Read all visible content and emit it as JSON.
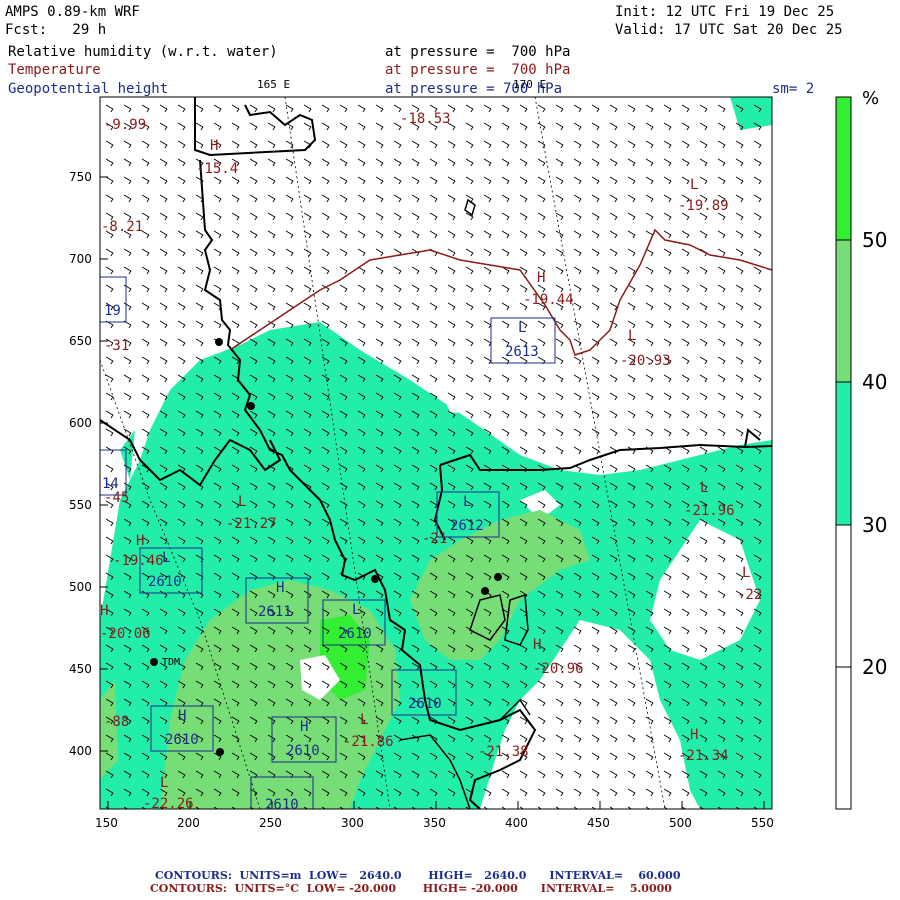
{
  "header": {
    "model": "AMPS 0.89-km WRF",
    "init": "Init: 12 UTC Fri 19 Dec 25",
    "fcst": "Fcst:   29 h",
    "valid": "Valid: 17 UTC Sat 20 Dec 25",
    "field1": "Relative humidity (w.r.t. water)",
    "field1_level": "at pressure =  700 hPa",
    "field2": "Temperature",
    "field2_level": "at pressure =  700 hPa",
    "field3": "Geopotential height",
    "field3_level": "at pressure = 700 hPa",
    "lon1": "165 E",
    "lon2": "170 E",
    "sm": "sm= 2"
  },
  "axes": {
    "x_ticks": [
      "150",
      "200",
      "250",
      "300",
      "350",
      "400",
      "450",
      "500",
      "550"
    ],
    "y_ticks": [
      "750",
      "700",
      "650",
      "600",
      "550",
      "500",
      "450",
      "400"
    ]
  },
  "colorbar": {
    "unit": "%",
    "labels": [
      "50",
      "40",
      "30",
      "20"
    ],
    "colors": [
      "#33ee33",
      "#77dd77",
      "#22eeaa",
      "#ffffff",
      "#ffffff"
    ]
  },
  "map_labels": {
    "temps": [
      {
        "name": "t1",
        "text": "-9.99"
      },
      {
        "name": "t2",
        "text": "-15.4"
      },
      {
        "name": "t3",
        "text": "-18.53"
      },
      {
        "name": "t4",
        "text": "-8.21"
      },
      {
        "name": "t5",
        "text": "-19.89"
      },
      {
        "name": "t6",
        "text": "-19.44"
      },
      {
        "name": "t7",
        "text": "-20.93"
      },
      {
        "name": "t8",
        "text": "-31"
      },
      {
        "name": "t9",
        "text": "-21.27"
      },
      {
        "name": "t10",
        "text": "-21.96"
      },
      {
        "name": "t11",
        "text": "-19.46"
      },
      {
        "name": "t12",
        "text": "-20.06"
      },
      {
        "name": "t13",
        "text": "-22"
      },
      {
        "name": "t14",
        "text": "-20.96"
      },
      {
        "name": "t15",
        "text": "-21.86"
      },
      {
        "name": "t16",
        "text": "-21.38"
      },
      {
        "name": "t17",
        "text": "-21.34"
      },
      {
        "name": "t18",
        "text": "-88"
      },
      {
        "name": "t19",
        "text": "-22.26"
      },
      {
        "name": "t20",
        "text": "-21"
      },
      {
        "name": "t21",
        "text": "-45"
      }
    ],
    "heights": [
      {
        "name": "h1",
        "text": "2613"
      },
      {
        "name": "h2",
        "text": "2612"
      },
      {
        "name": "h3",
        "text": "2610"
      },
      {
        "name": "h4",
        "text": "2611"
      },
      {
        "name": "h5",
        "text": "2610"
      },
      {
        "name": "h6",
        "text": "2610"
      },
      {
        "name": "h7",
        "text": "2610"
      },
      {
        "name": "h8",
        "text": "2610"
      },
      {
        "name": "h9",
        "text": "19"
      },
      {
        "name": "h10",
        "text": "14"
      },
      {
        "name": "h11",
        "text": "2610"
      }
    ],
    "station": "TDM"
  },
  "footer": {
    "row1": "CONTOURS:  UNITS=m  LOW=   2640.0       HIGH=   2640.0      INTERVAL=    60.000",
    "row2": "CONTOURS:  UNITS=°C  LOW= -20.000       HIGH= -20.000      INTERVAL=    5.0000"
  }
}
